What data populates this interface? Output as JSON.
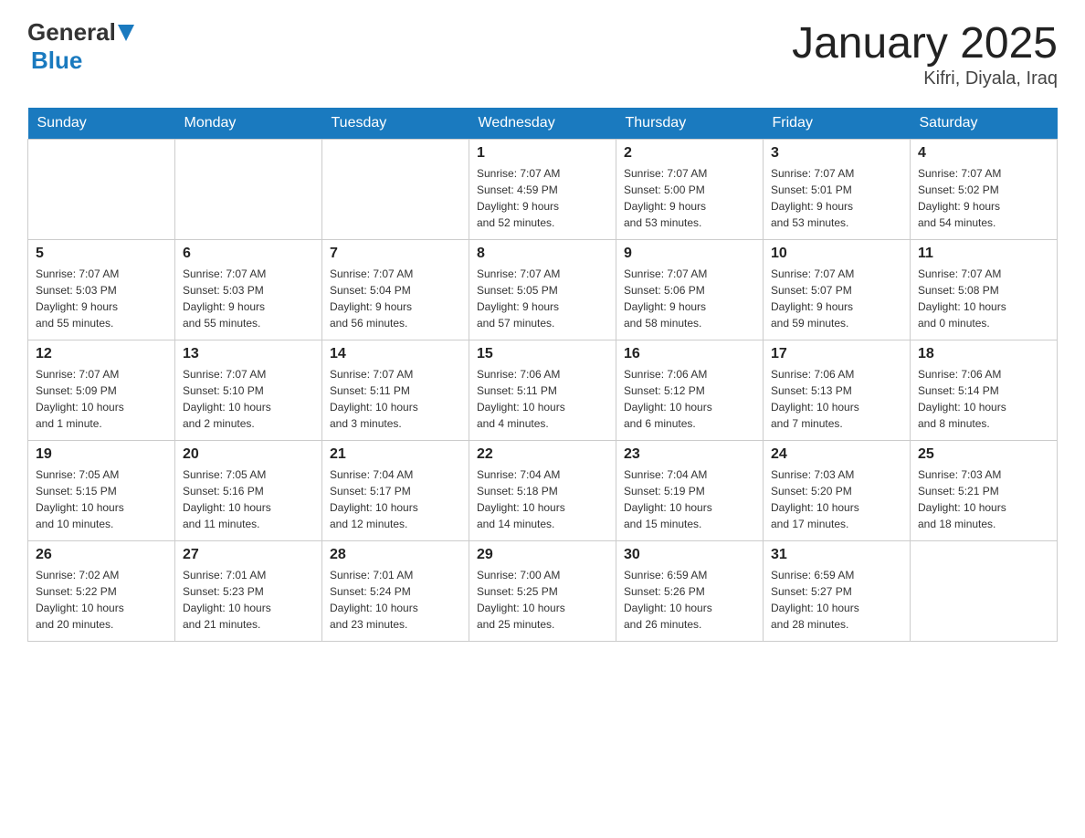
{
  "header": {
    "logo": {
      "general": "General",
      "blue": "Blue"
    },
    "title": "January 2025",
    "subtitle": "Kifri, Diyala, Iraq"
  },
  "weekdays": [
    "Sunday",
    "Monday",
    "Tuesday",
    "Wednesday",
    "Thursday",
    "Friday",
    "Saturday"
  ],
  "weeks": [
    [
      {
        "day": "",
        "info": ""
      },
      {
        "day": "",
        "info": ""
      },
      {
        "day": "",
        "info": ""
      },
      {
        "day": "1",
        "info": "Sunrise: 7:07 AM\nSunset: 4:59 PM\nDaylight: 9 hours\nand 52 minutes."
      },
      {
        "day": "2",
        "info": "Sunrise: 7:07 AM\nSunset: 5:00 PM\nDaylight: 9 hours\nand 53 minutes."
      },
      {
        "day": "3",
        "info": "Sunrise: 7:07 AM\nSunset: 5:01 PM\nDaylight: 9 hours\nand 53 minutes."
      },
      {
        "day": "4",
        "info": "Sunrise: 7:07 AM\nSunset: 5:02 PM\nDaylight: 9 hours\nand 54 minutes."
      }
    ],
    [
      {
        "day": "5",
        "info": "Sunrise: 7:07 AM\nSunset: 5:03 PM\nDaylight: 9 hours\nand 55 minutes."
      },
      {
        "day": "6",
        "info": "Sunrise: 7:07 AM\nSunset: 5:03 PM\nDaylight: 9 hours\nand 55 minutes."
      },
      {
        "day": "7",
        "info": "Sunrise: 7:07 AM\nSunset: 5:04 PM\nDaylight: 9 hours\nand 56 minutes."
      },
      {
        "day": "8",
        "info": "Sunrise: 7:07 AM\nSunset: 5:05 PM\nDaylight: 9 hours\nand 57 minutes."
      },
      {
        "day": "9",
        "info": "Sunrise: 7:07 AM\nSunset: 5:06 PM\nDaylight: 9 hours\nand 58 minutes."
      },
      {
        "day": "10",
        "info": "Sunrise: 7:07 AM\nSunset: 5:07 PM\nDaylight: 9 hours\nand 59 minutes."
      },
      {
        "day": "11",
        "info": "Sunrise: 7:07 AM\nSunset: 5:08 PM\nDaylight: 10 hours\nand 0 minutes."
      }
    ],
    [
      {
        "day": "12",
        "info": "Sunrise: 7:07 AM\nSunset: 5:09 PM\nDaylight: 10 hours\nand 1 minute."
      },
      {
        "day": "13",
        "info": "Sunrise: 7:07 AM\nSunset: 5:10 PM\nDaylight: 10 hours\nand 2 minutes."
      },
      {
        "day": "14",
        "info": "Sunrise: 7:07 AM\nSunset: 5:11 PM\nDaylight: 10 hours\nand 3 minutes."
      },
      {
        "day": "15",
        "info": "Sunrise: 7:06 AM\nSunset: 5:11 PM\nDaylight: 10 hours\nand 4 minutes."
      },
      {
        "day": "16",
        "info": "Sunrise: 7:06 AM\nSunset: 5:12 PM\nDaylight: 10 hours\nand 6 minutes."
      },
      {
        "day": "17",
        "info": "Sunrise: 7:06 AM\nSunset: 5:13 PM\nDaylight: 10 hours\nand 7 minutes."
      },
      {
        "day": "18",
        "info": "Sunrise: 7:06 AM\nSunset: 5:14 PM\nDaylight: 10 hours\nand 8 minutes."
      }
    ],
    [
      {
        "day": "19",
        "info": "Sunrise: 7:05 AM\nSunset: 5:15 PM\nDaylight: 10 hours\nand 10 minutes."
      },
      {
        "day": "20",
        "info": "Sunrise: 7:05 AM\nSunset: 5:16 PM\nDaylight: 10 hours\nand 11 minutes."
      },
      {
        "day": "21",
        "info": "Sunrise: 7:04 AM\nSunset: 5:17 PM\nDaylight: 10 hours\nand 12 minutes."
      },
      {
        "day": "22",
        "info": "Sunrise: 7:04 AM\nSunset: 5:18 PM\nDaylight: 10 hours\nand 14 minutes."
      },
      {
        "day": "23",
        "info": "Sunrise: 7:04 AM\nSunset: 5:19 PM\nDaylight: 10 hours\nand 15 minutes."
      },
      {
        "day": "24",
        "info": "Sunrise: 7:03 AM\nSunset: 5:20 PM\nDaylight: 10 hours\nand 17 minutes."
      },
      {
        "day": "25",
        "info": "Sunrise: 7:03 AM\nSunset: 5:21 PM\nDaylight: 10 hours\nand 18 minutes."
      }
    ],
    [
      {
        "day": "26",
        "info": "Sunrise: 7:02 AM\nSunset: 5:22 PM\nDaylight: 10 hours\nand 20 minutes."
      },
      {
        "day": "27",
        "info": "Sunrise: 7:01 AM\nSunset: 5:23 PM\nDaylight: 10 hours\nand 21 minutes."
      },
      {
        "day": "28",
        "info": "Sunrise: 7:01 AM\nSunset: 5:24 PM\nDaylight: 10 hours\nand 23 minutes."
      },
      {
        "day": "29",
        "info": "Sunrise: 7:00 AM\nSunset: 5:25 PM\nDaylight: 10 hours\nand 25 minutes."
      },
      {
        "day": "30",
        "info": "Sunrise: 6:59 AM\nSunset: 5:26 PM\nDaylight: 10 hours\nand 26 minutes."
      },
      {
        "day": "31",
        "info": "Sunrise: 6:59 AM\nSunset: 5:27 PM\nDaylight: 10 hours\nand 28 minutes."
      },
      {
        "day": "",
        "info": ""
      }
    ]
  ]
}
